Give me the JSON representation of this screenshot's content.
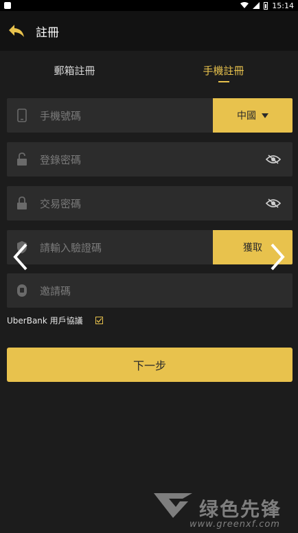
{
  "status_bar": {
    "time": "15:14"
  },
  "app_bar": {
    "title": "註冊"
  },
  "tabs": [
    {
      "label": "郵箱註冊",
      "active": false
    },
    {
      "label": "手機註冊",
      "active": true
    }
  ],
  "form": {
    "phone": {
      "placeholder": "手機號碼",
      "country": "中國"
    },
    "login_password": {
      "placeholder": "登錄密碼"
    },
    "trade_password": {
      "placeholder": "交易密碼"
    },
    "code": {
      "placeholder": "請輸入驗證碼",
      "get_label": "獲取"
    },
    "invite": {
      "placeholder": "邀請碼"
    }
  },
  "agreement": {
    "label": "UberBank 用戶協議",
    "checked": true
  },
  "next_button": {
    "label": "下一步"
  },
  "watermark": {
    "brand": "绿色先锋",
    "url": "www.greenxf.com"
  },
  "colors": {
    "accent": "#e8c24d",
    "background": "#1c1c1c",
    "field": "#2c2c2c",
    "appbar": "#121212"
  }
}
